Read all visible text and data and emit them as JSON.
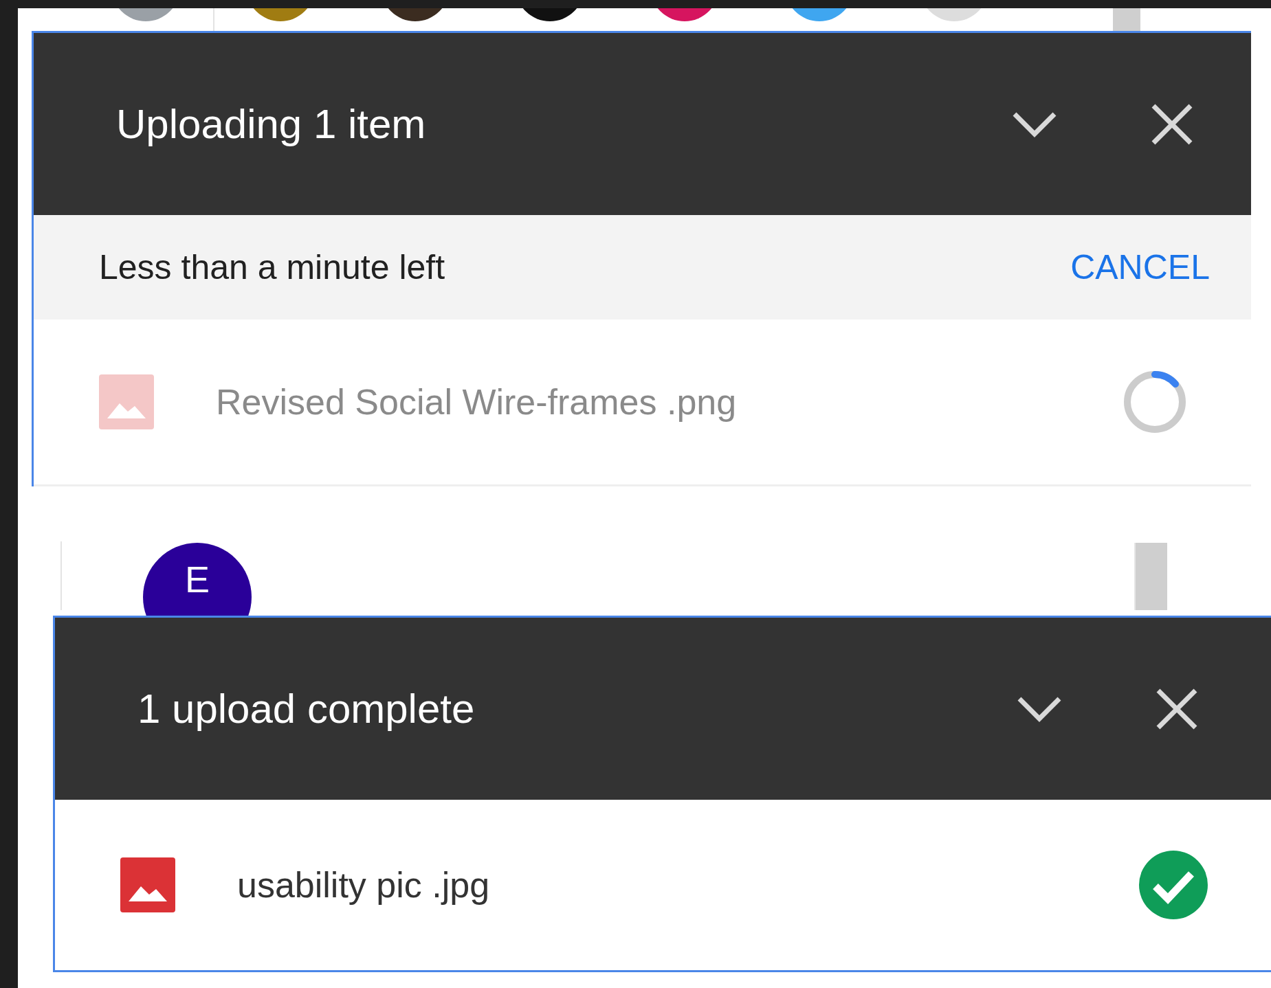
{
  "avatar_strip": {
    "avatars": [
      {
        "color": "#9aa0a6"
      },
      {
        "color": "#a07c12"
      },
      {
        "color": "#3b2c20"
      },
      {
        "color": "#111111"
      },
      {
        "color": "#d6155f"
      },
      {
        "color": "#3fa6f0"
      },
      {
        "color": "#dddddd"
      }
    ]
  },
  "panels": [
    {
      "title": "Uploading 1 item",
      "status": {
        "text": "Less than a minute left",
        "action": "CANCEL"
      },
      "files": [
        {
          "name": "Revised Social Wire-frames .png",
          "complete": false
        }
      ]
    },
    {
      "title": "1 upload complete",
      "files": [
        {
          "name": "usability pic .jpg",
          "complete": true
        }
      ]
    }
  ],
  "contact": {
    "initial": "E",
    "color": "#2a0099"
  }
}
